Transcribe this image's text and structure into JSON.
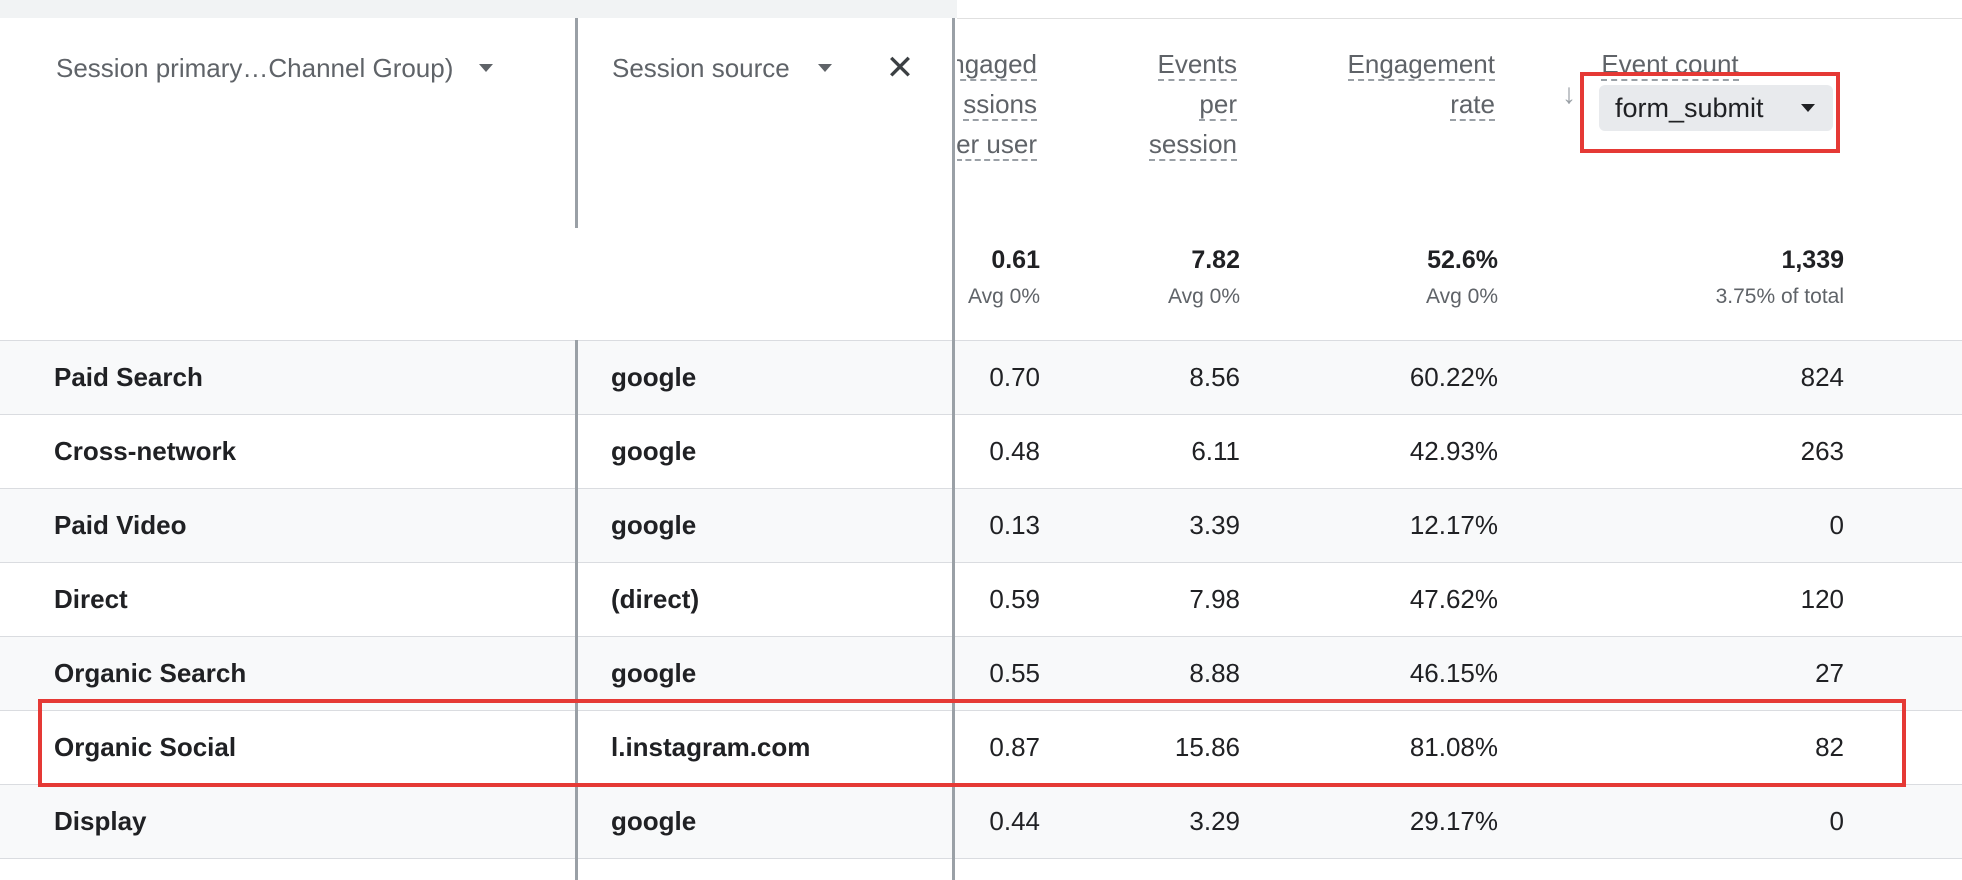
{
  "header": {
    "dim1_label": "Session primary…Channel Group)",
    "dim2_label": "Session source",
    "close_label": "✕",
    "metric_columns": [
      {
        "lines": [
          "ngaged",
          "ssions",
          "er user"
        ]
      },
      {
        "lines": [
          "Events",
          "per",
          "session"
        ]
      },
      {
        "lines": [
          "Engagement",
          "rate"
        ]
      },
      {
        "lines": [
          "Event count"
        ]
      }
    ],
    "sort_icon": "arrow-down-icon",
    "event_filter_value": "form_submit"
  },
  "totals": [
    {
      "value": "0.61",
      "sub": "Avg 0%"
    },
    {
      "value": "7.82",
      "sub": "Avg 0%"
    },
    {
      "value": "52.6%",
      "sub": "Avg 0%"
    },
    {
      "value": "1,339",
      "sub": "3.75% of total"
    }
  ],
  "rows": [
    {
      "channel": "Paid Search",
      "source": "google",
      "m1": "0.70",
      "m2": "8.56",
      "m3": "60.22%",
      "m4": "824"
    },
    {
      "channel": "Cross-network",
      "source": "google",
      "m1": "0.48",
      "m2": "6.11",
      "m3": "42.93%",
      "m4": "263"
    },
    {
      "channel": "Paid Video",
      "source": "google",
      "m1": "0.13",
      "m2": "3.39",
      "m3": "12.17%",
      "m4": "0"
    },
    {
      "channel": "Direct",
      "source": "(direct)",
      "m1": "0.59",
      "m2": "7.98",
      "m3": "47.62%",
      "m4": "120"
    },
    {
      "channel": "Organic Search",
      "source": "google",
      "m1": "0.55",
      "m2": "8.88",
      "m3": "46.15%",
      "m4": "27"
    },
    {
      "channel": "Organic Social",
      "source": "l.instagram.com",
      "m1": "0.87",
      "m2": "15.86",
      "m3": "81.08%",
      "m4": "82"
    },
    {
      "channel": "Display",
      "source": "google",
      "m1": "0.44",
      "m2": "3.29",
      "m3": "29.17%",
      "m4": "0"
    }
  ],
  "colors": {
    "highlight": "#e53935",
    "alt_row": "#f8f9fa",
    "divider": "#9aa0a6"
  }
}
